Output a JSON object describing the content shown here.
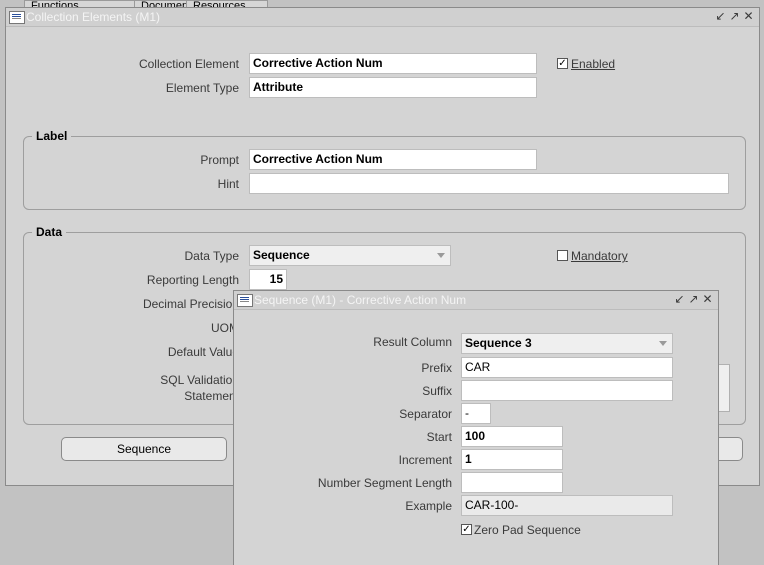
{
  "tabs": [
    "Functions",
    "Documents",
    "Resources"
  ],
  "main_window": {
    "title": "Collection Elements (M1)",
    "collection_element_label": "Collection Element",
    "collection_element_value": "Corrective Action Num",
    "enabled_label": "Enabled",
    "element_type_label": "Element Type",
    "element_type_value": "Attribute",
    "label_group": {
      "title": "Label",
      "prompt_label": "Prompt",
      "prompt_value": "Corrective Action Num",
      "hint_label": "Hint",
      "hint_value": ""
    },
    "data_group": {
      "title": "Data",
      "data_type_label": "Data Type",
      "data_type_value": "Sequence",
      "mandatory_label": "Mandatory",
      "reporting_length_label": "Reporting Length",
      "reporting_length_value": "15",
      "decimal_precision_label": "Decimal Precision",
      "uom_label": "UOM",
      "default_value_label": "Default Value",
      "sql_validation_label_1": "SQL Validation",
      "sql_validation_label_2": "Statement"
    },
    "sequence_button": "Sequence"
  },
  "sequence_window": {
    "title": "Sequence (M1) - Corrective Action Num",
    "result_column_label": "Result Column",
    "result_column_value": "Sequence 3",
    "prefix_label": "Prefix",
    "prefix_value": "CAR",
    "suffix_label": "Suffix",
    "suffix_value": "",
    "separator_label": "Separator",
    "separator_value": "-",
    "start_label": "Start",
    "start_value": "100",
    "increment_label": "Increment",
    "increment_value": "1",
    "number_segment_length_label": "Number Segment Length",
    "number_segment_length_value": "",
    "example_label": "Example",
    "example_value": "CAR-100-",
    "zero_pad_label": "Zero Pad Sequence"
  },
  "icons": {
    "window_controls": [
      "minimize-icon",
      "maximize-icon",
      "close-icon"
    ],
    "app_icon": "oracle-forms-icon"
  }
}
